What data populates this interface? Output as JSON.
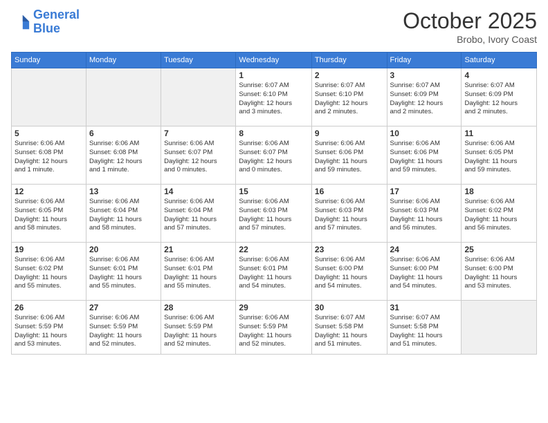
{
  "header": {
    "logo_line1": "General",
    "logo_line2": "Blue",
    "month": "October 2025",
    "location": "Brobo, Ivory Coast"
  },
  "weekdays": [
    "Sunday",
    "Monday",
    "Tuesday",
    "Wednesday",
    "Thursday",
    "Friday",
    "Saturday"
  ],
  "weeks": [
    [
      {
        "day": "",
        "info": ""
      },
      {
        "day": "",
        "info": ""
      },
      {
        "day": "",
        "info": ""
      },
      {
        "day": "1",
        "info": "Sunrise: 6:07 AM\nSunset: 6:10 PM\nDaylight: 12 hours\nand 3 minutes."
      },
      {
        "day": "2",
        "info": "Sunrise: 6:07 AM\nSunset: 6:10 PM\nDaylight: 12 hours\nand 2 minutes."
      },
      {
        "day": "3",
        "info": "Sunrise: 6:07 AM\nSunset: 6:09 PM\nDaylight: 12 hours\nand 2 minutes."
      },
      {
        "day": "4",
        "info": "Sunrise: 6:07 AM\nSunset: 6:09 PM\nDaylight: 12 hours\nand 2 minutes."
      }
    ],
    [
      {
        "day": "5",
        "info": "Sunrise: 6:06 AM\nSunset: 6:08 PM\nDaylight: 12 hours\nand 1 minute."
      },
      {
        "day": "6",
        "info": "Sunrise: 6:06 AM\nSunset: 6:08 PM\nDaylight: 12 hours\nand 1 minute."
      },
      {
        "day": "7",
        "info": "Sunrise: 6:06 AM\nSunset: 6:07 PM\nDaylight: 12 hours\nand 0 minutes."
      },
      {
        "day": "8",
        "info": "Sunrise: 6:06 AM\nSunset: 6:07 PM\nDaylight: 12 hours\nand 0 minutes."
      },
      {
        "day": "9",
        "info": "Sunrise: 6:06 AM\nSunset: 6:06 PM\nDaylight: 11 hours\nand 59 minutes."
      },
      {
        "day": "10",
        "info": "Sunrise: 6:06 AM\nSunset: 6:06 PM\nDaylight: 11 hours\nand 59 minutes."
      },
      {
        "day": "11",
        "info": "Sunrise: 6:06 AM\nSunset: 6:05 PM\nDaylight: 11 hours\nand 59 minutes."
      }
    ],
    [
      {
        "day": "12",
        "info": "Sunrise: 6:06 AM\nSunset: 6:05 PM\nDaylight: 11 hours\nand 58 minutes."
      },
      {
        "day": "13",
        "info": "Sunrise: 6:06 AM\nSunset: 6:04 PM\nDaylight: 11 hours\nand 58 minutes."
      },
      {
        "day": "14",
        "info": "Sunrise: 6:06 AM\nSunset: 6:04 PM\nDaylight: 11 hours\nand 57 minutes."
      },
      {
        "day": "15",
        "info": "Sunrise: 6:06 AM\nSunset: 6:03 PM\nDaylight: 11 hours\nand 57 minutes."
      },
      {
        "day": "16",
        "info": "Sunrise: 6:06 AM\nSunset: 6:03 PM\nDaylight: 11 hours\nand 57 minutes."
      },
      {
        "day": "17",
        "info": "Sunrise: 6:06 AM\nSunset: 6:03 PM\nDaylight: 11 hours\nand 56 minutes."
      },
      {
        "day": "18",
        "info": "Sunrise: 6:06 AM\nSunset: 6:02 PM\nDaylight: 11 hours\nand 56 minutes."
      }
    ],
    [
      {
        "day": "19",
        "info": "Sunrise: 6:06 AM\nSunset: 6:02 PM\nDaylight: 11 hours\nand 55 minutes."
      },
      {
        "day": "20",
        "info": "Sunrise: 6:06 AM\nSunset: 6:01 PM\nDaylight: 11 hours\nand 55 minutes."
      },
      {
        "day": "21",
        "info": "Sunrise: 6:06 AM\nSunset: 6:01 PM\nDaylight: 11 hours\nand 55 minutes."
      },
      {
        "day": "22",
        "info": "Sunrise: 6:06 AM\nSunset: 6:01 PM\nDaylight: 11 hours\nand 54 minutes."
      },
      {
        "day": "23",
        "info": "Sunrise: 6:06 AM\nSunset: 6:00 PM\nDaylight: 11 hours\nand 54 minutes."
      },
      {
        "day": "24",
        "info": "Sunrise: 6:06 AM\nSunset: 6:00 PM\nDaylight: 11 hours\nand 54 minutes."
      },
      {
        "day": "25",
        "info": "Sunrise: 6:06 AM\nSunset: 6:00 PM\nDaylight: 11 hours\nand 53 minutes."
      }
    ],
    [
      {
        "day": "26",
        "info": "Sunrise: 6:06 AM\nSunset: 5:59 PM\nDaylight: 11 hours\nand 53 minutes."
      },
      {
        "day": "27",
        "info": "Sunrise: 6:06 AM\nSunset: 5:59 PM\nDaylight: 11 hours\nand 52 minutes."
      },
      {
        "day": "28",
        "info": "Sunrise: 6:06 AM\nSunset: 5:59 PM\nDaylight: 11 hours\nand 52 minutes."
      },
      {
        "day": "29",
        "info": "Sunrise: 6:06 AM\nSunset: 5:59 PM\nDaylight: 11 hours\nand 52 minutes."
      },
      {
        "day": "30",
        "info": "Sunrise: 6:07 AM\nSunset: 5:58 PM\nDaylight: 11 hours\nand 51 minutes."
      },
      {
        "day": "31",
        "info": "Sunrise: 6:07 AM\nSunset: 5:58 PM\nDaylight: 11 hours\nand 51 minutes."
      },
      {
        "day": "",
        "info": ""
      }
    ]
  ]
}
